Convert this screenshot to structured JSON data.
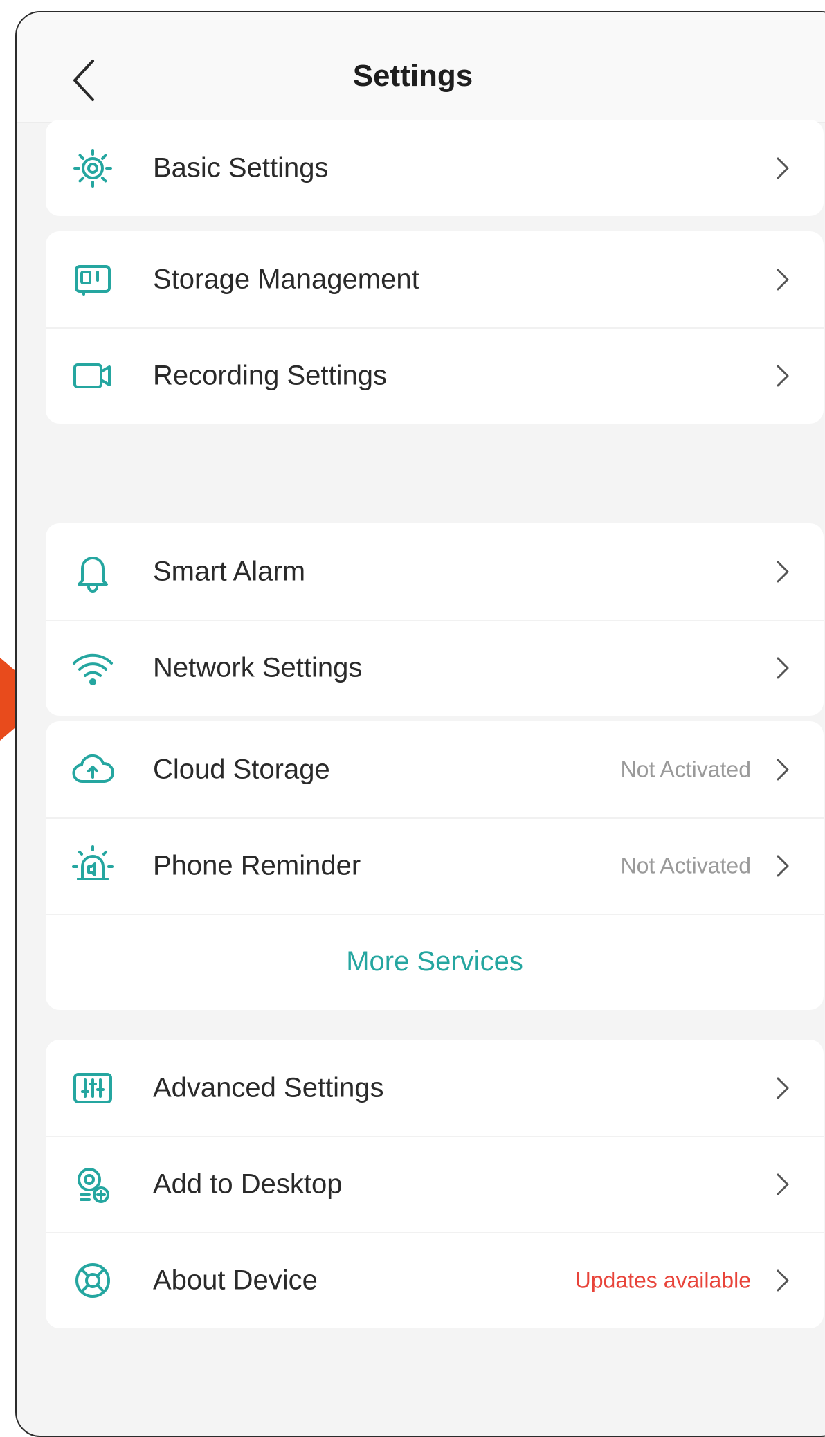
{
  "header": {
    "title": "Settings"
  },
  "groups": [
    {
      "items": [
        {
          "label": "Basic Settings",
          "icon": "gear-icon"
        }
      ]
    },
    {
      "items": [
        {
          "label": "Storage Management",
          "icon": "storage-icon"
        },
        {
          "label": "Recording Settings",
          "icon": "video-camera-icon"
        }
      ]
    },
    {
      "items": [
        {
          "label": "Smart Alarm",
          "icon": "bell-icon"
        },
        {
          "label": "Network Settings",
          "icon": "wifi-icon"
        }
      ]
    },
    {
      "items": [
        {
          "label": "Cloud Storage",
          "icon": "cloud-upload-icon",
          "status": "Not Activated"
        },
        {
          "label": "Phone Reminder",
          "icon": "siren-icon",
          "status": "Not Activated"
        }
      ],
      "footer_link": "More Services"
    },
    {
      "items": [
        {
          "label": "Advanced Settings",
          "icon": "sliders-icon"
        },
        {
          "label": "Add to Desktop",
          "icon": "add-to-desktop-icon"
        },
        {
          "label": "About Device",
          "icon": "lifebuoy-icon",
          "status": "Updates available"
        }
      ]
    }
  ],
  "colors": {
    "accent": "#25a6a0",
    "alert": "#e8443a",
    "background": "#f4f4f4",
    "pointer": "#e84b1c"
  }
}
